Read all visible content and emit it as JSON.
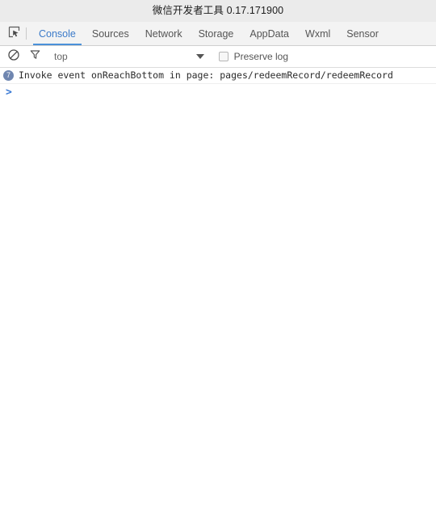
{
  "window": {
    "title": "微信开发者工具 0.17.171900"
  },
  "toolbar": {
    "inspect_icon": "inspect-element-icon",
    "tabs": [
      {
        "label": "Console",
        "active": true
      },
      {
        "label": "Sources",
        "active": false
      },
      {
        "label": "Network",
        "active": false
      },
      {
        "label": "Storage",
        "active": false
      },
      {
        "label": "AppData",
        "active": false
      },
      {
        "label": "Wxml",
        "active": false
      },
      {
        "label": "Sensor",
        "active": false
      }
    ]
  },
  "filterbar": {
    "clear_icon": "clear-console-icon",
    "filter_icon": "funnel-filter-icon",
    "context_value": "top",
    "context_chevron_icon": "chevron-down-icon",
    "preserve_log_label": "Preserve log",
    "preserve_log_checked": false
  },
  "console": {
    "messages": [
      {
        "badge": "7",
        "text": "Invoke event onReachBottom in page: pages/redeemRecord/redeemRecord"
      }
    ],
    "prompt_symbol": ">",
    "prompt_value": ""
  },
  "colors": {
    "titlebar_bg": "#ebebeb",
    "tabbar_bg": "#f3f3f3",
    "accent": "#4a90d9",
    "badge_bg": "#6f86b0",
    "prompt": "#3b7ad4"
  }
}
